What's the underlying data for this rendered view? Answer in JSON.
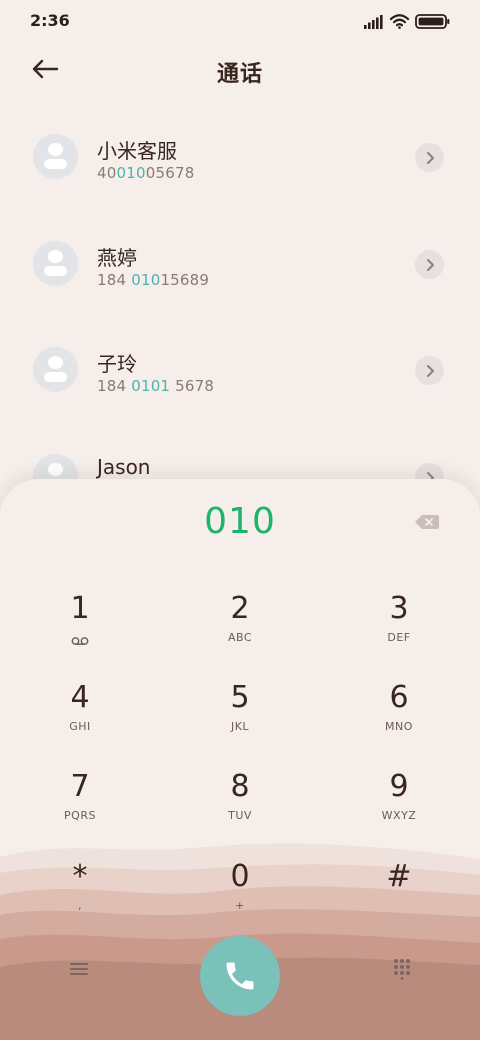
{
  "status_bar": {
    "time": "2:36",
    "icons": [
      "signal-icon",
      "wifi-icon",
      "battery-icon"
    ]
  },
  "header": {
    "title": "通话",
    "back_icon": "arrow-left-icon"
  },
  "contacts": [
    {
      "name": "小米客服",
      "number_pre": "40",
      "number_match": "010",
      "number_post": "05678"
    },
    {
      "name": "燕婷",
      "number_pre": "184 ",
      "number_match": "010",
      "number_post": "15689"
    },
    {
      "name": "子玲",
      "number_pre": "184 ",
      "number_match": "0101",
      "number_post": " 5678"
    },
    {
      "name": "Jason",
      "number_pre": "",
      "number_match": "",
      "number_post": ""
    }
  ],
  "dialer": {
    "input": "010",
    "keys": [
      {
        "digit": "1",
        "letters": "",
        "sub_icon": "voicemail-icon"
      },
      {
        "digit": "2",
        "letters": "ABC"
      },
      {
        "digit": "3",
        "letters": "DEF"
      },
      {
        "digit": "4",
        "letters": "GHI"
      },
      {
        "digit": "5",
        "letters": "JKL"
      },
      {
        "digit": "6",
        "letters": "MNO"
      },
      {
        "digit": "7",
        "letters": "PQRS"
      },
      {
        "digit": "8",
        "letters": "TUV"
      },
      {
        "digit": "9",
        "letters": "WXYZ"
      },
      {
        "digit": "*",
        "letters": ","
      },
      {
        "digit": "0",
        "letters": "+"
      },
      {
        "digit": "#",
        "letters": ""
      }
    ]
  },
  "colors": {
    "background": "#f5eeea",
    "dial_text": "#1db36b",
    "match_highlight": "#4fb2ad",
    "call_button": "#79c1b9"
  }
}
